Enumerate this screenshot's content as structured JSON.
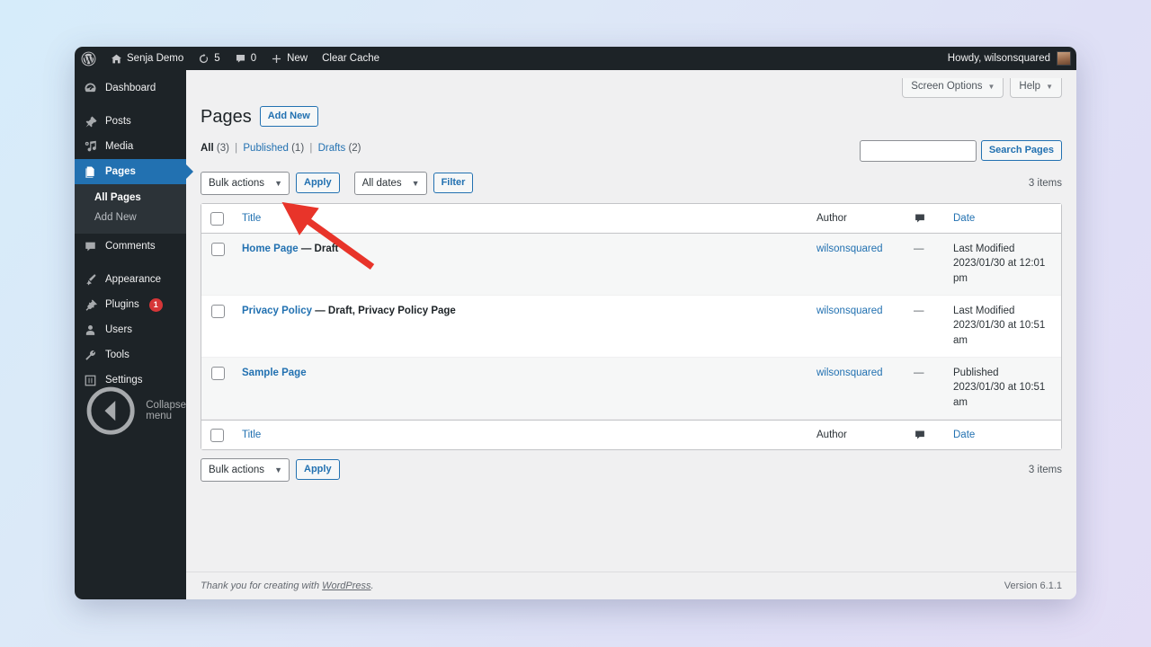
{
  "adminbar": {
    "site_name": "Senja Demo",
    "updates_count": "5",
    "comments_count": "0",
    "new_label": "New",
    "clear_cache_label": "Clear Cache",
    "howdy": "Howdy, wilsonsquared"
  },
  "sidebar": {
    "items": [
      {
        "label": "Dashboard",
        "icon": "dashboard-icon",
        "current": false
      },
      {
        "label": "Posts",
        "icon": "pin-icon",
        "current": false
      },
      {
        "label": "Media",
        "icon": "media-icon",
        "current": false
      },
      {
        "label": "Pages",
        "icon": "pages-icon",
        "current": true
      },
      {
        "label": "Comments",
        "icon": "comment-icon",
        "current": false
      },
      {
        "label": "Appearance",
        "icon": "brush-icon",
        "current": false
      },
      {
        "label": "Plugins",
        "icon": "plug-icon",
        "current": false,
        "badge": "1"
      },
      {
        "label": "Users",
        "icon": "user-icon",
        "current": false
      },
      {
        "label": "Tools",
        "icon": "wrench-icon",
        "current": false
      },
      {
        "label": "Settings",
        "icon": "settings-icon",
        "current": false
      }
    ],
    "submenu": [
      {
        "label": "All Pages",
        "current": true
      },
      {
        "label": "Add New",
        "current": false
      }
    ],
    "collapse_label": "Collapse menu"
  },
  "screen_meta": {
    "screen_options_label": "Screen Options",
    "help_label": "Help",
    "caret": "▼"
  },
  "header": {
    "title": "Pages",
    "add_new_label": "Add New"
  },
  "subsubsub": {
    "all_label": "All",
    "all_count": "(3)",
    "published_label": "Published",
    "published_count": "(1)",
    "drafts_label": "Drafts",
    "drafts_count": "(2)",
    "separator": "|"
  },
  "search": {
    "value": "",
    "placeholder": "",
    "button_label": "Search Pages"
  },
  "tablenav_top": {
    "bulk_actions_label": "Bulk actions",
    "apply_label": "Apply",
    "dates_label": "All dates",
    "filter_label": "Filter",
    "items_count": "3 items"
  },
  "tablenav_bottom": {
    "bulk_actions_label": "Bulk actions",
    "apply_label": "Apply",
    "items_count": "3 items"
  },
  "table": {
    "columns": {
      "title": "Title",
      "author": "Author",
      "comments": "comment-icon",
      "date": "Date"
    },
    "rows": [
      {
        "title": "Home Page",
        "state": "— Draft",
        "author": "wilsonsquared",
        "comments": "—",
        "date_status": "Last Modified",
        "date_value": "2023/01/30 at 12:01 pm"
      },
      {
        "title": "Privacy Policy",
        "state": "— Draft, Privacy Policy Page",
        "author": "wilsonsquared",
        "comments": "—",
        "date_status": "Last Modified",
        "date_value": "2023/01/30 at 10:51 am"
      },
      {
        "title": "Sample Page",
        "state": "",
        "author": "wilsonsquared",
        "comments": "—",
        "date_status": "Published",
        "date_value": "2023/01/30 at 10:51 am"
      }
    ]
  },
  "footer": {
    "thanks_prefix": "Thank you for creating with ",
    "wordpress_link": "WordPress",
    "thanks_suffix": ".",
    "version": "Version 6.1.1"
  },
  "annotation": {
    "arrow_color": "#e8342a"
  }
}
